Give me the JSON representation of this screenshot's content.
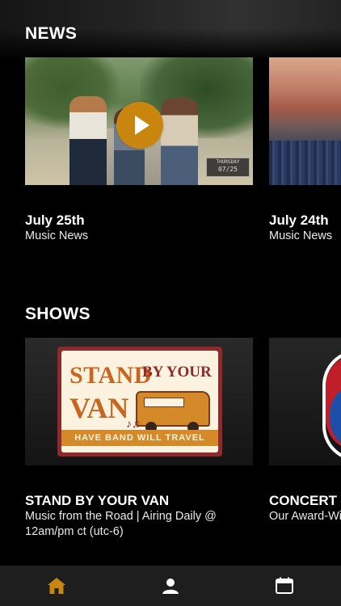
{
  "sections": {
    "news": {
      "title": "NEWS",
      "items": [
        {
          "title": "July 25th",
          "subtitle": "Music News",
          "badge_day": "THURSDAY",
          "badge_date": "07/25"
        },
        {
          "title": "July 24th",
          "subtitle": "Music News"
        }
      ]
    },
    "shows": {
      "title": "SHOWS",
      "items": [
        {
          "title": "STAND BY YOUR VAN",
          "subtitle": "Music from the Road | Airing Daily @ 12am/pm ct (utc-6)",
          "logo_stand": "STAND",
          "logo_by_your": "BY YOUR",
          "logo_van": "VAN",
          "logo_tagline": "HAVE BAND WILL TRAVEL"
        },
        {
          "title": "CONCERT",
          "subtitle": "Our Award-Winning Live Music Series"
        }
      ]
    }
  },
  "tabbar": {
    "items": [
      {
        "name": "home",
        "icon": "home-icon",
        "active": true
      },
      {
        "name": "profile",
        "icon": "person-icon",
        "active": false
      },
      {
        "name": "schedule",
        "icon": "calendar-icon",
        "active": false
      }
    ]
  },
  "colors": {
    "accent": "#c8860f",
    "background": "#000000",
    "tabbar": "#1e1e1e"
  }
}
